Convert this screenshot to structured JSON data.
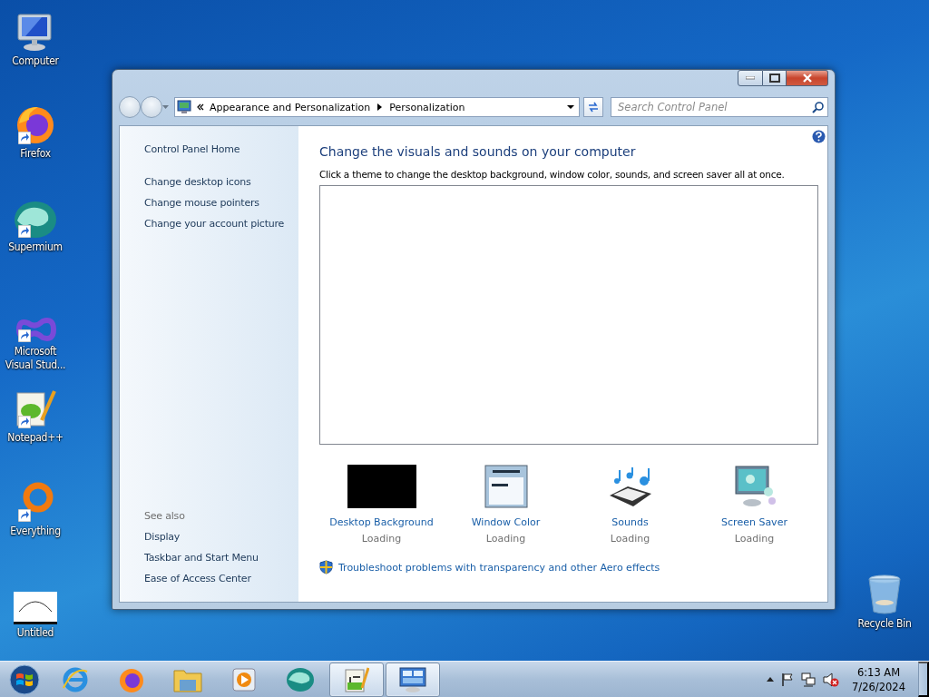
{
  "desktop_icons": [
    {
      "label": "Computer",
      "kind": "computer",
      "shortcut": false
    },
    {
      "label": "Firefox",
      "kind": "firefox",
      "shortcut": true
    },
    {
      "label": "Supermium",
      "kind": "supermium",
      "shortcut": true
    },
    {
      "label": "Microsoft Visual Stud...",
      "kind": "visualstudio",
      "shortcut": true
    },
    {
      "label": "Notepad++",
      "kind": "notepad",
      "shortcut": true
    },
    {
      "label": "Everything",
      "kind": "everything",
      "shortcut": true
    },
    {
      "label": "Untitled",
      "kind": "paint",
      "shortcut": false
    },
    {
      "label": "Recycle Bin",
      "kind": "recycle",
      "shortcut": false
    }
  ],
  "window": {
    "breadcrumb": [
      "Appearance and Personalization",
      "Personalization"
    ],
    "search": {
      "placeholder": "Search Control Panel"
    },
    "sidebar": {
      "home": "Control Panel Home",
      "tasks": [
        "Change desktop icons",
        "Change mouse pointers",
        "Change your account picture"
      ],
      "see_also_title": "See also",
      "see_also": [
        "Display",
        "Taskbar and Start Menu",
        "Ease of Access Center"
      ]
    },
    "heading": "Change the visuals and sounds on your computer",
    "description": "Click a theme to change the desktop background, window color, sounds, and screen saver all at once.",
    "settings": [
      {
        "kind": "background",
        "label": "Desktop Background",
        "status": "Loading"
      },
      {
        "kind": "color",
        "label": "Window Color",
        "status": "Loading"
      },
      {
        "kind": "sounds",
        "label": "Sounds",
        "status": "Loading"
      },
      {
        "kind": "saver",
        "label": "Screen Saver",
        "status": "Loading"
      }
    ],
    "troubleshoot": "Troubleshoot problems with transparency and other Aero effects"
  },
  "taskbar": {
    "items": [
      {
        "kind": "ie",
        "selected": false
      },
      {
        "kind": "firefox",
        "selected": false
      },
      {
        "kind": "explorer",
        "selected": false
      },
      {
        "kind": "media",
        "selected": false
      },
      {
        "kind": "supermium",
        "selected": false
      },
      {
        "kind": "notepad",
        "selected": true
      },
      {
        "kind": "controlpanel",
        "selected": true
      }
    ],
    "time": "6:13 AM",
    "date": "7/26/2024"
  }
}
